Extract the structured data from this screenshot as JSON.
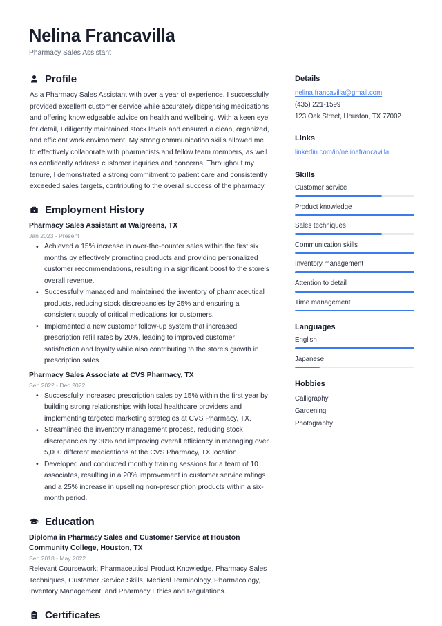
{
  "header": {
    "name": "Nelina Francavilla",
    "job_title": "Pharmacy Sales Assistant"
  },
  "sections": {
    "profile": {
      "title": "Profile",
      "icon": "person-icon",
      "text": "As a Pharmacy Sales Assistant with over a year of experience, I successfully provided excellent customer service while accurately dispensing medications and offering knowledgeable advice on health and wellbeing. With a keen eye for detail, I diligently maintained stock levels and ensured a clean, organized, and efficient work environment. My strong communication skills allowed me to effectively collaborate with pharmacists and fellow team members, as well as confidently address customer inquiries and concerns. Throughout my tenure, I demonstrated a strong commitment to patient care and consistently exceeded sales targets, contributing to the overall success of the pharmacy."
    },
    "employment": {
      "title": "Employment History",
      "icon": "briefcase-icon",
      "entries": [
        {
          "title": "Pharmacy Sales Assistant at Walgreens, TX",
          "date": "Jan 2023 - Present",
          "bullets": [
            "Achieved a 15% increase in over-the-counter sales within the first six months by effectively promoting products and providing personalized customer recommendations, resulting in a significant boost to the store's overall revenue.",
            "Successfully managed and maintained the inventory of pharmaceutical products, reducing stock discrepancies by 25% and ensuring a consistent supply of critical medications for customers.",
            "Implemented a new customer follow-up system that increased prescription refill rates by 20%, leading to improved customer satisfaction and loyalty while also contributing to the store's growth in prescription sales."
          ]
        },
        {
          "title": "Pharmacy Sales Associate at CVS Pharmacy, TX",
          "date": "Sep 2022 - Dec 2022",
          "bullets": [
            "Successfully increased prescription sales by 15% within the first year by building strong relationships with local healthcare providers and implementing targeted marketing strategies at CVS Pharmacy, TX.",
            "Streamlined the inventory management process, reducing stock discrepancies by 30% and improving overall efficiency in managing over 5,000 different medications at the CVS Pharmacy, TX location.",
            "Developed and conducted monthly training sessions for a team of 10 associates, resulting in a 20% improvement in customer service ratings and a 25% increase in upselling non-prescription products within a six-month period."
          ]
        }
      ]
    },
    "education": {
      "title": "Education",
      "icon": "graduation-cap-icon",
      "entries": [
        {
          "title": "Diploma in Pharmacy Sales and Customer Service at Houston Community College, Houston, TX",
          "date": "Sep 2018 - May 2022",
          "description": "Relevant Coursework: Pharmaceutical Product Knowledge, Pharmacy Sales Techniques, Customer Service Skills, Medical Terminology, Pharmacology, Inventory Management, and Pharmacy Ethics and Regulations."
        }
      ]
    },
    "certificates": {
      "title": "Certificates",
      "icon": "clipboard-icon"
    }
  },
  "sidebar": {
    "details": {
      "title": "Details",
      "email": "nelina.francavilla@gmail.com",
      "phone": "(435) 221-1599",
      "address": "123 Oak Street, Houston, TX 77002"
    },
    "links": {
      "title": "Links",
      "items": [
        {
          "label": "linkedin.com/in/nelinafrancavilla"
        }
      ]
    },
    "skills": {
      "title": "Skills",
      "items": [
        {
          "label": "Customer service",
          "level": 73
        },
        {
          "label": "Product knowledge",
          "level": 100
        },
        {
          "label": "Sales techniques",
          "level": 73
        },
        {
          "label": "Communication skills",
          "level": 100
        },
        {
          "label": "Inventory management",
          "level": 100
        },
        {
          "label": "Attention to detail",
          "level": 100
        },
        {
          "label": "Time management",
          "level": 100
        }
      ]
    },
    "languages": {
      "title": "Languages",
      "items": [
        {
          "label": "English",
          "level": 100
        },
        {
          "label": "Japanese",
          "level": 21
        }
      ]
    },
    "hobbies": {
      "title": "Hobbies",
      "items": [
        "Calligraphy",
        "Gardening",
        "Photography"
      ]
    }
  },
  "colors": {
    "accent": "#3b7af0",
    "link": "#4a7fe8",
    "text": "#2a3040",
    "heading": "#1a1f2e",
    "muted": "#8b929e",
    "track": "#e7e9ed"
  }
}
